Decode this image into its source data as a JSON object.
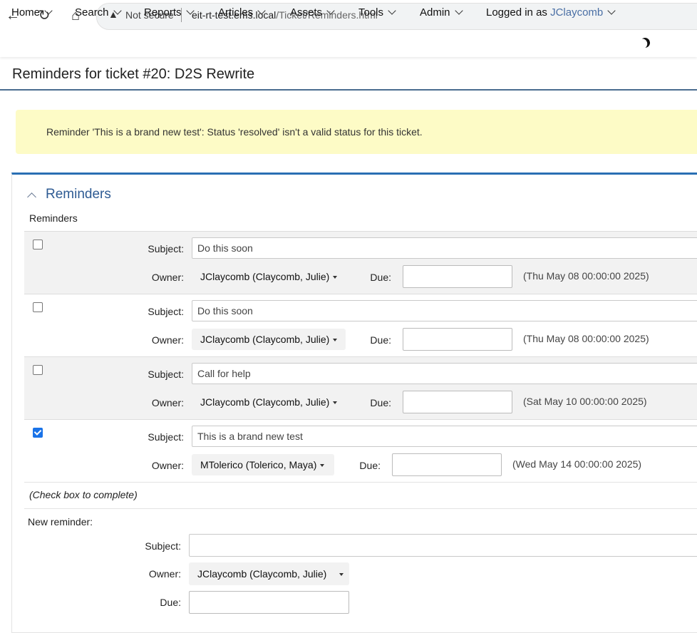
{
  "browser": {
    "not_secure": "Not secure",
    "url_host": "eit-rt-test.ems.local",
    "url_path": "/Ticket/Reminders.html"
  },
  "menu": {
    "items": [
      "Home",
      "Search",
      "Reports",
      "Articles",
      "Assets",
      "Tools",
      "Admin"
    ],
    "logged_in_prefix": "Logged in as",
    "user": "JClaycomb"
  },
  "page_title": "Reminders for ticket #20: D2S Rewrite",
  "alert": "Reminder 'This is a brand new test': Status 'resolved' isn't a valid status for this ticket.",
  "panel": {
    "title": "Reminders",
    "subtitle": "Reminders",
    "subject_label": "Subject:",
    "owner_label": "Owner:",
    "due_label": "Due:",
    "reminders": [
      {
        "subject": "Do this soon",
        "owner": "JClaycomb (Claycomb, Julie)",
        "due": "(Thu May 08 00:00:00 2025)",
        "checked": false
      },
      {
        "subject": "Do this soon",
        "owner": "JClaycomb (Claycomb, Julie)",
        "due": "(Thu May 08 00:00:00 2025)",
        "checked": false
      },
      {
        "subject": "Call for help",
        "owner": "JClaycomb (Claycomb, Julie)",
        "due": "(Sat May 10 00:00:00 2025)",
        "checked": false
      },
      {
        "subject": "This is a brand new test",
        "owner": "MTolerico (Tolerico, Maya)",
        "due": "(Wed May 14 00:00:00 2025)",
        "checked": true
      }
    ],
    "hint": "(Check box to complete)",
    "new_reminder": {
      "label": "New reminder:",
      "subject_label": "Subject:",
      "owner_label": "Owner:",
      "due_label": "Due:",
      "subject_value": "",
      "owner": "JClaycomb (Claycomb, Julie)"
    }
  }
}
